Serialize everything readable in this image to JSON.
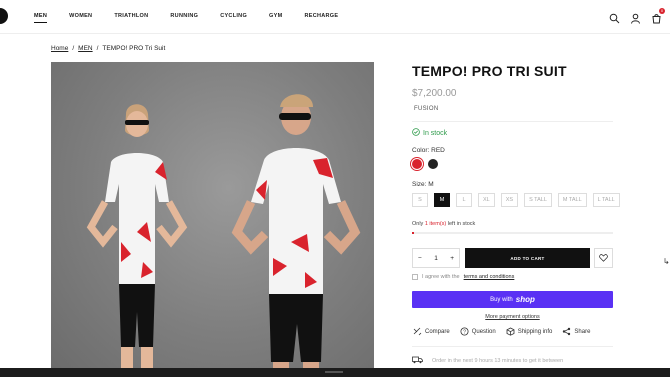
{
  "header": {
    "nav": [
      "MEN",
      "WOMEN",
      "TRIATHLON",
      "RUNNING",
      "CYCLING",
      "GYM",
      "RECHARGE"
    ],
    "active_nav": "MEN",
    "icons": [
      "search-icon",
      "user-icon",
      "cart-icon"
    ],
    "cart_count": "0"
  },
  "breadcrumb": {
    "home": "Home",
    "sep": "/",
    "men": "MEN",
    "current": "TEMPO! PRO Tri Suit"
  },
  "product": {
    "title": "TEMPO! PRO TRI SUIT",
    "price": "$7,200.00",
    "vendor": "FUSION",
    "stock": "In stock",
    "color_label": "Color:",
    "color_value": "RED",
    "size_label": "Size:",
    "size_value": "M",
    "sizes": [
      "S",
      "M",
      "L",
      "XL",
      "XS",
      "S TALL",
      "M TALL",
      "L TALL"
    ],
    "low_stock_prefix": "Only",
    "low_stock_count": "1 item(s)",
    "low_stock_suffix": "left in stock",
    "stock_level_percent": 1,
    "quantity": "1",
    "add_to_cart": "ADD TO CART",
    "agree_text": "I agree with the",
    "terms_link": "terms and conditions",
    "buy_with": "Buy with",
    "shop": "shop",
    "more_payment": "More payment options",
    "actions": [
      "Compare",
      "Question",
      "Shipping info",
      "Share"
    ],
    "delivery_text": "Order in the next 9 hours 13 minutes to get it between"
  },
  "colors": {
    "accent_red": "#d9232d",
    "shop_purple": "#5a31f4",
    "stock_green": "#2e9b4b"
  }
}
